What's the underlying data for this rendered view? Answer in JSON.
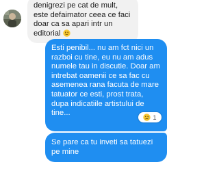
{
  "conversation": {
    "incoming": {
      "text": "denigrezi pe cat de mult, este defaimator ceea ce faci doar ca sa apari intr un editorial",
      "emoji": "smiling-face-icon"
    },
    "outgoing": [
      {
        "text": "Esti penibil... nu am fct nici un razboi cu tine, eu nu am adus numele tau in discutie. Doar am intrebat oamenii ce sa fac cu asemenea rana facuta de mare tatuator ce esti, prost trata, dupa indicatiile artistului de tine..."
      },
      {
        "text": "Se pare ca tu inveti sa tatuezi pe mine"
      }
    ],
    "reaction": {
      "emoji": "sad-face-icon",
      "count": "1"
    }
  },
  "colors": {
    "outgoing_bubble": "#1f8ef1",
    "incoming_bubble": "#f1f1f1"
  }
}
